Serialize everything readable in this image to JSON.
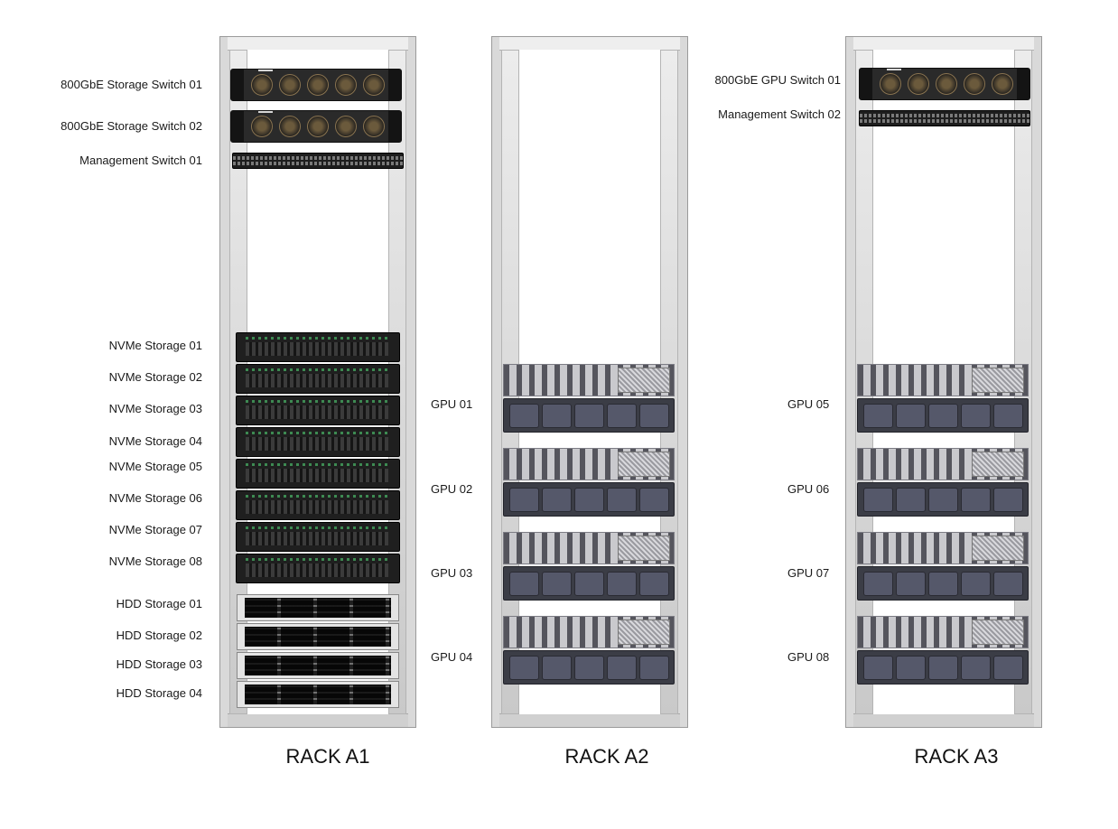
{
  "racks": [
    {
      "title": "RACK A1",
      "labels": {
        "storage_switch_01": "800GbE Storage Switch 01",
        "storage_switch_02": "800GbE Storage Switch 02",
        "mgmt_switch_01": "Management Switch 01",
        "nvme_01": "NVMe Storage 01",
        "nvme_02": "NVMe Storage 02",
        "nvme_03": "NVMe Storage 03",
        "nvme_04": "NVMe Storage 04",
        "nvme_05": "NVMe Storage 05",
        "nvme_06": "NVMe Storage 06",
        "nvme_07": "NVMe Storage 07",
        "nvme_08": "NVMe Storage 08",
        "hdd_01": "HDD Storage 01",
        "hdd_02": "HDD Storage 02",
        "hdd_03": "HDD Storage 03",
        "hdd_04": "HDD Storage 04"
      }
    },
    {
      "title": "RACK A2",
      "labels": {
        "gpu_01": "GPU 01",
        "gpu_02": "GPU 02",
        "gpu_03": "GPU 03",
        "gpu_04": "GPU 04"
      }
    },
    {
      "title": "RACK A3",
      "labels": {
        "gpu_switch_01": "800GbE GPU Switch 01",
        "mgmt_switch_02": "Management Switch 02",
        "gpu_05": "GPU 05",
        "gpu_06": "GPU 06",
        "gpu_07": "GPU 07",
        "gpu_08": "GPU 08"
      }
    }
  ]
}
